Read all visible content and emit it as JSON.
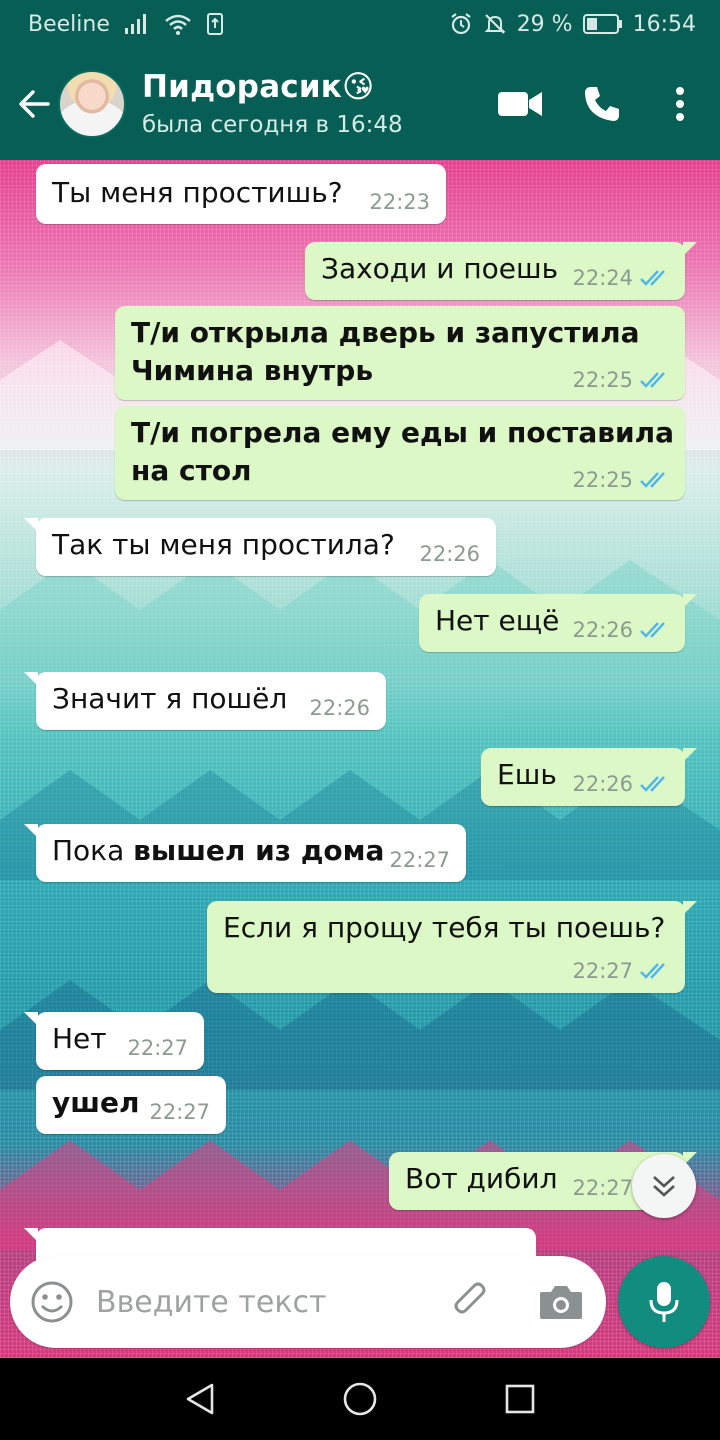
{
  "status_bar": {
    "carrier": "Beeline",
    "battery_percent": "29 %",
    "time": "16:54",
    "icons": [
      "signal-icon",
      "wifi-icon",
      "sim-icon",
      "alarm-icon",
      "mute-icon",
      "battery-icon"
    ]
  },
  "header": {
    "contact_name": "Пидорасик",
    "contact_emoji": "😘",
    "last_seen": "была сегодня в 16:48",
    "icons": [
      "back-arrow-icon",
      "avatar",
      "video-camera-icon",
      "phone-icon",
      "more-vert-icon"
    ]
  },
  "messages": [
    {
      "dir": "in",
      "text": "Ты меня простишь?",
      "time": "22:23",
      "bold": false
    },
    {
      "dir": "out",
      "text": "Заходи и поешь",
      "time": "22:24",
      "bold": false,
      "read": true
    },
    {
      "dir": "out",
      "line1": "Т/и открыла дверь и запустила",
      "line2": "Чимина внутрь",
      "time": "22:25",
      "bold": true,
      "read": true
    },
    {
      "dir": "out",
      "line1": "Т/и погрела ему еды и поставила",
      "line2": "на стол",
      "time": "22:25",
      "bold": true,
      "read": true
    },
    {
      "dir": "in",
      "text": "Так ты меня простила?",
      "time": "22:26",
      "bold": false
    },
    {
      "dir": "out",
      "text": "Нет ещё",
      "time": "22:26",
      "bold": false,
      "read": true
    },
    {
      "dir": "in",
      "text": "Значит я пошёл",
      "time": "22:26",
      "bold": false
    },
    {
      "dir": "out",
      "text": "Ешь",
      "time": "22:26",
      "bold": false,
      "read": true
    },
    {
      "dir": "in",
      "plain": "Пока ",
      "strong": "вышел из дома",
      "time": "22:27"
    },
    {
      "dir": "out",
      "text": "Если я прощу тебя ты поешь?",
      "time": "22:27",
      "bold": false,
      "read": true
    },
    {
      "dir": "in",
      "text": "Нет",
      "time": "22:27",
      "bold": false
    },
    {
      "dir": "in",
      "text": "ушел",
      "time": "22:27",
      "bold": true
    },
    {
      "dir": "out",
      "text": "Вот дибил",
      "time": "22:27",
      "bold": false,
      "read": true
    }
  ],
  "colors": {
    "header": "#075e54",
    "incoming_bubble": "#ffffff",
    "outgoing_bubble": "#dcf8c6",
    "read_ticks": "#4fb6ec",
    "mic_button": "#128c7e"
  },
  "composer": {
    "placeholder": "Введите текст",
    "icons": [
      "emoji-icon",
      "paperclip-icon",
      "camera-icon",
      "microphone-icon"
    ]
  },
  "scroll_button_icon": "double-chevron-down-icon",
  "nav_bar": {
    "icons": [
      "back-triangle-icon",
      "home-circle-icon",
      "recents-square-icon"
    ]
  }
}
